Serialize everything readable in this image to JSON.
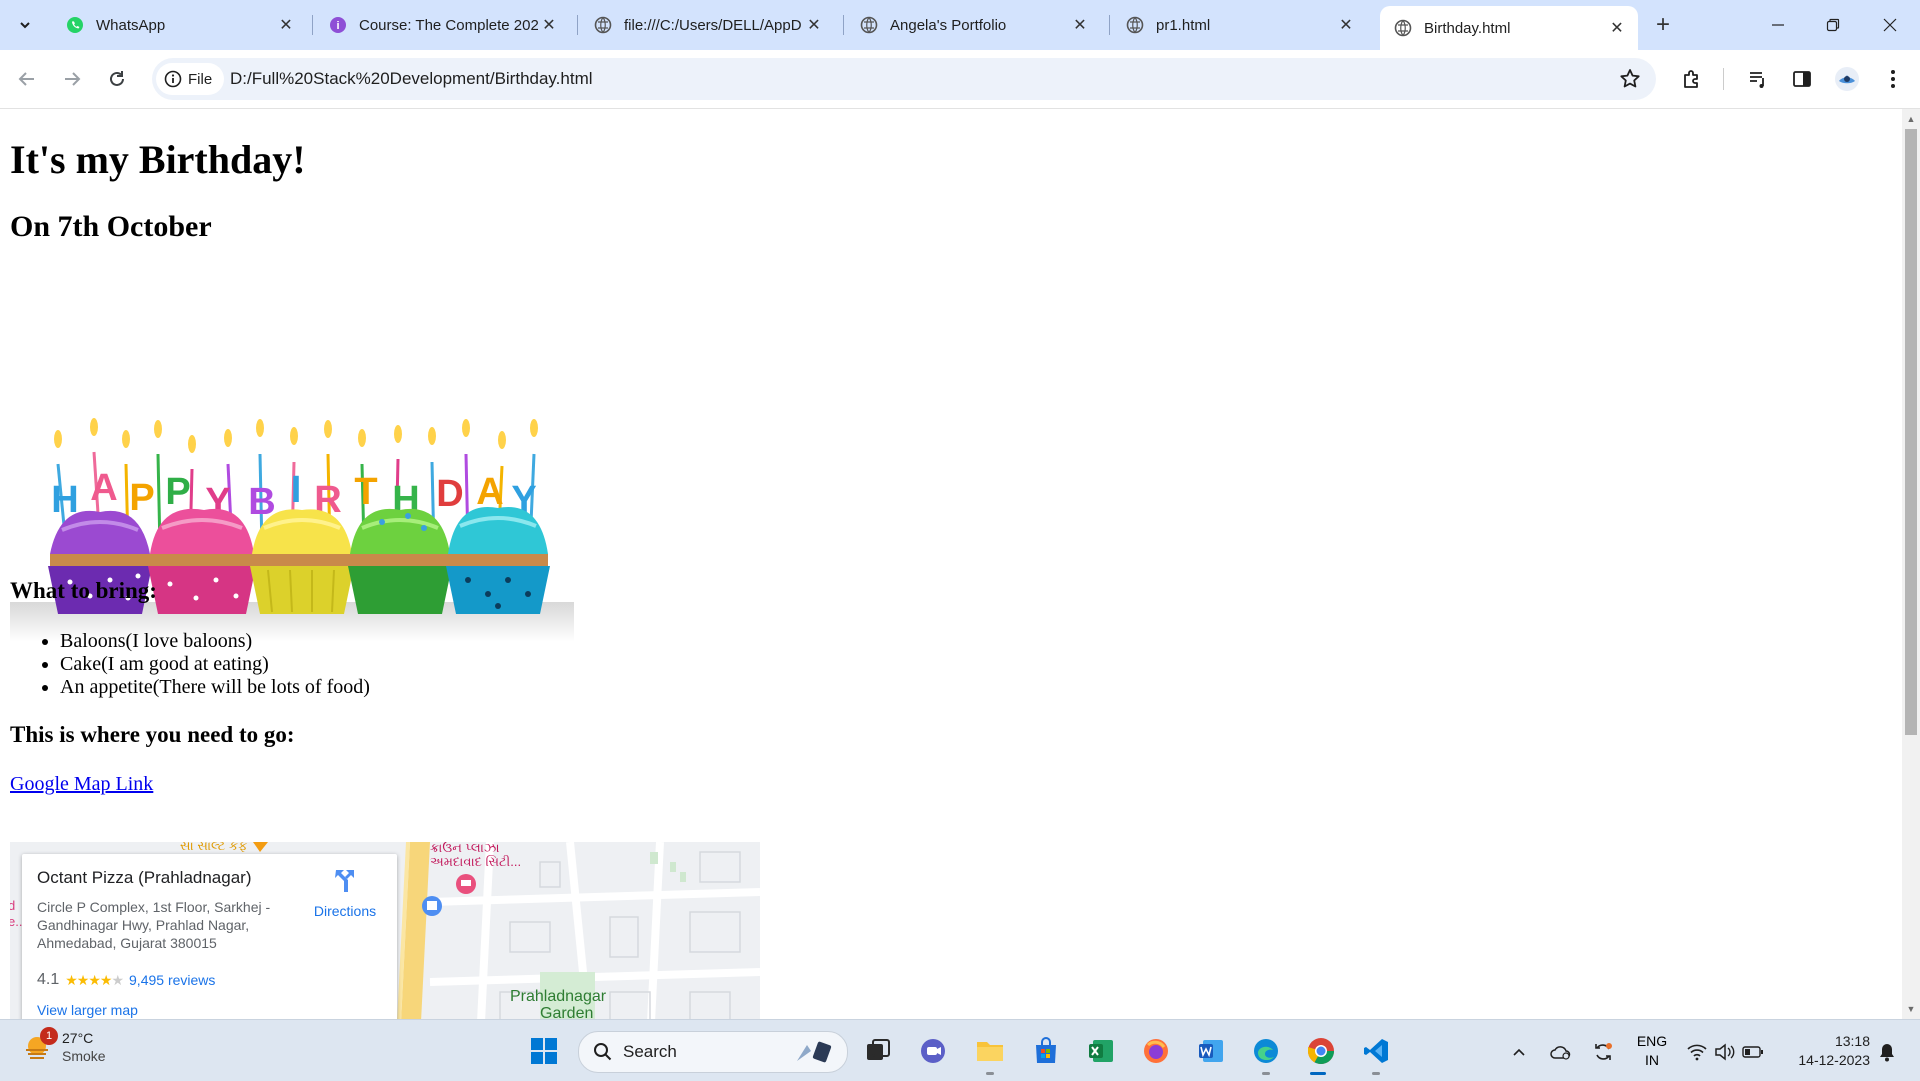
{
  "browser": {
    "tabs": [
      {
        "title": "WhatsApp",
        "icon": "whatsapp-icon",
        "active": false
      },
      {
        "title": "Course: The Complete 202",
        "icon": "course-icon",
        "active": false
      },
      {
        "title": "file:///C:/Users/DELL/AppD",
        "icon": "globe-icon",
        "active": false
      },
      {
        "title": "Angela's Portfolio",
        "icon": "globe-icon",
        "active": false
      },
      {
        "title": "pr1.html",
        "icon": "globe-icon",
        "active": false
      },
      {
        "title": "Birthday.html",
        "icon": "globe-icon",
        "active": true
      }
    ],
    "omnibox": {
      "chip_label": "File",
      "url": "D:/Full%20Stack%20Development/Birthday.html"
    }
  },
  "page": {
    "h1": "It's my Birthday!",
    "h2": "On 7th October",
    "image_letters": [
      "H",
      "A",
      "P",
      "P",
      "Y",
      "B",
      "I",
      "R",
      "T",
      "H",
      "D",
      "A",
      "Y"
    ],
    "bring_heading": "What to bring:",
    "bring_items": [
      "Baloons(I love baloons)",
      "Cake(I am good at eating)",
      "An appetite(There will be lots of food)"
    ],
    "go_heading": "This is where you need to go:",
    "map_link": "Google Map Link",
    "map": {
      "place_name": "Octant Pizza (Prahladnagar)",
      "address": "Circle P Complex, 1st Floor, Sarkhej - Gandhinagar Hwy, Prahlad Nagar, Ahmedabad, Gujarat 380015",
      "directions_label": "Directions",
      "rating": "4.1",
      "reviews": "9,495 reviews",
      "view_larger": "View larger map",
      "poi_1": "ક્રાઉન પ્લાઝા",
      "poi_1b": "અમદાવાદ સિટી...",
      "poi_2": "Prahladnagar",
      "poi_2b": "Garden",
      "poi_3": "સા સાલ્ટ કફ"
    }
  },
  "taskbar": {
    "weather_temp": "27°C",
    "weather_cond": "Smoke",
    "notification_count": "1",
    "search_label": "Search",
    "lang_top": "ENG",
    "lang_bottom": "IN",
    "time": "13:18",
    "date": "14-12-2023"
  },
  "colors": {
    "tabstrip": "#d3e3fd",
    "link": "#0000ee",
    "accent": "#0067c0"
  }
}
